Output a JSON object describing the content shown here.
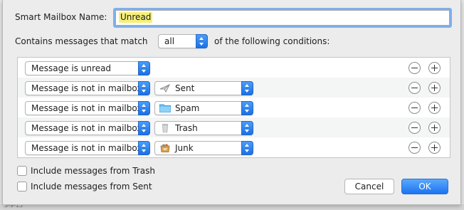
{
  "dialog": {
    "name_label": "Smart Mailbox Name:",
    "name_value": "Unread",
    "match_prefix": "Contains messages that match",
    "match_value": "all",
    "match_suffix": "of the following conditions:"
  },
  "rules": [
    {
      "condition": "Message is unread"
    },
    {
      "condition": "Message is not in mailbox",
      "mailbox": "Sent",
      "icon": "sent-icon"
    },
    {
      "condition": "Message is not in mailbox",
      "mailbox": "Spam",
      "icon": "folder-icon"
    },
    {
      "condition": "Message is not in mailbox",
      "mailbox": "Trash",
      "icon": "trash-icon"
    },
    {
      "condition": "Message is not in mailbox",
      "mailbox": "Junk",
      "icon": "junk-icon"
    }
  ],
  "options": {
    "include_trash": "Include messages from Trash",
    "include_sent": "Include messages from Sent"
  },
  "buttons": {
    "cancel": "Cancel",
    "ok": "OK"
  },
  "colors": {
    "accent": "#1b74f0",
    "highlight": "#f6f07a",
    "focus_ring": "#7fb0ea"
  },
  "background_fragment": "3-9-15"
}
